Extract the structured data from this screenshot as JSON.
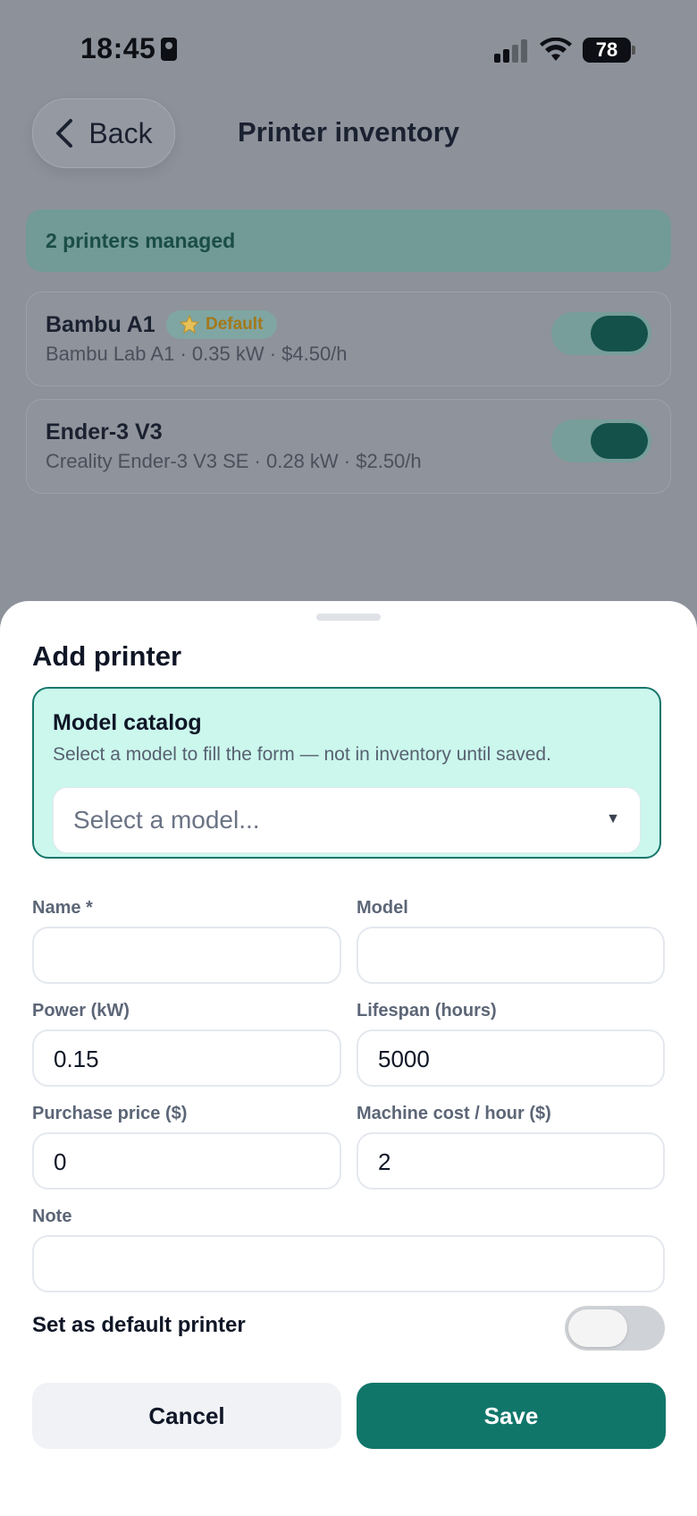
{
  "status_bar": {
    "time": "18:45",
    "battery": "78"
  },
  "header": {
    "back_label": "Back",
    "title": "Printer inventory"
  },
  "summary_banner": "2 printers managed",
  "printers": [
    {
      "name": "Bambu A1",
      "badge": "Default",
      "details": "Bambu Lab A1 · 0.35 kW · $4.50/h",
      "enabled": true
    },
    {
      "name": "Ender-3 V3",
      "details": "Creality Ender-3 V3 SE · 0.28 kW · $2.50/h",
      "enabled": true
    }
  ],
  "sheet": {
    "title": "Add printer",
    "catalog": {
      "title": "Model catalog",
      "hint": "Select a model to fill the form — not in inventory until saved.",
      "select_placeholder": "Select a model..."
    },
    "fields": {
      "name": {
        "label": "Name *",
        "value": ""
      },
      "model": {
        "label": "Model",
        "value": ""
      },
      "power": {
        "label": "Power (kW)",
        "value": "0.15"
      },
      "lifespan": {
        "label": "Lifespan (hours)",
        "value": "5000"
      },
      "purchase_price": {
        "label": "Purchase price ($)",
        "value": "0"
      },
      "machine_cost": {
        "label": "Machine cost / hour ($)",
        "value": "2"
      },
      "note": {
        "label": "Note",
        "value": ""
      }
    },
    "default_toggle": {
      "label": "Set as default printer",
      "on": false
    },
    "cancel_label": "Cancel",
    "save_label": "Save"
  },
  "colors": {
    "accent": "#11766a",
    "catalog_bg": "#cbf7ed",
    "badge_text": "#a3791a"
  }
}
